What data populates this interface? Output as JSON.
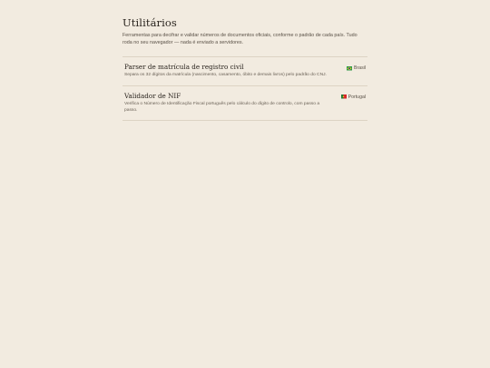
{
  "page": {
    "title": "Utilitários",
    "intro": "Ferramentas para decifrar e validar números de documentos oficiais, conforme o padrão de cada país. Tudo roda no seu navegador — nada é enviado a servidores."
  },
  "tools": [
    {
      "title": "Parser de matrícula de registro civil",
      "description": "Separa os 32 dígitos da matrícula (nascimento, casamento, óbito e demais livros) pelo padrão do CNJ.",
      "country": "Brasil",
      "flag_icon": "brazil-flag-icon"
    },
    {
      "title": "Validador de NIF",
      "description": "Verifica o Número de Identificação Fiscal português pelo cálculo do dígito de controlo, com passo a passo.",
      "country": "Portugal",
      "flag_icon": "portugal-flag-icon"
    }
  ]
}
